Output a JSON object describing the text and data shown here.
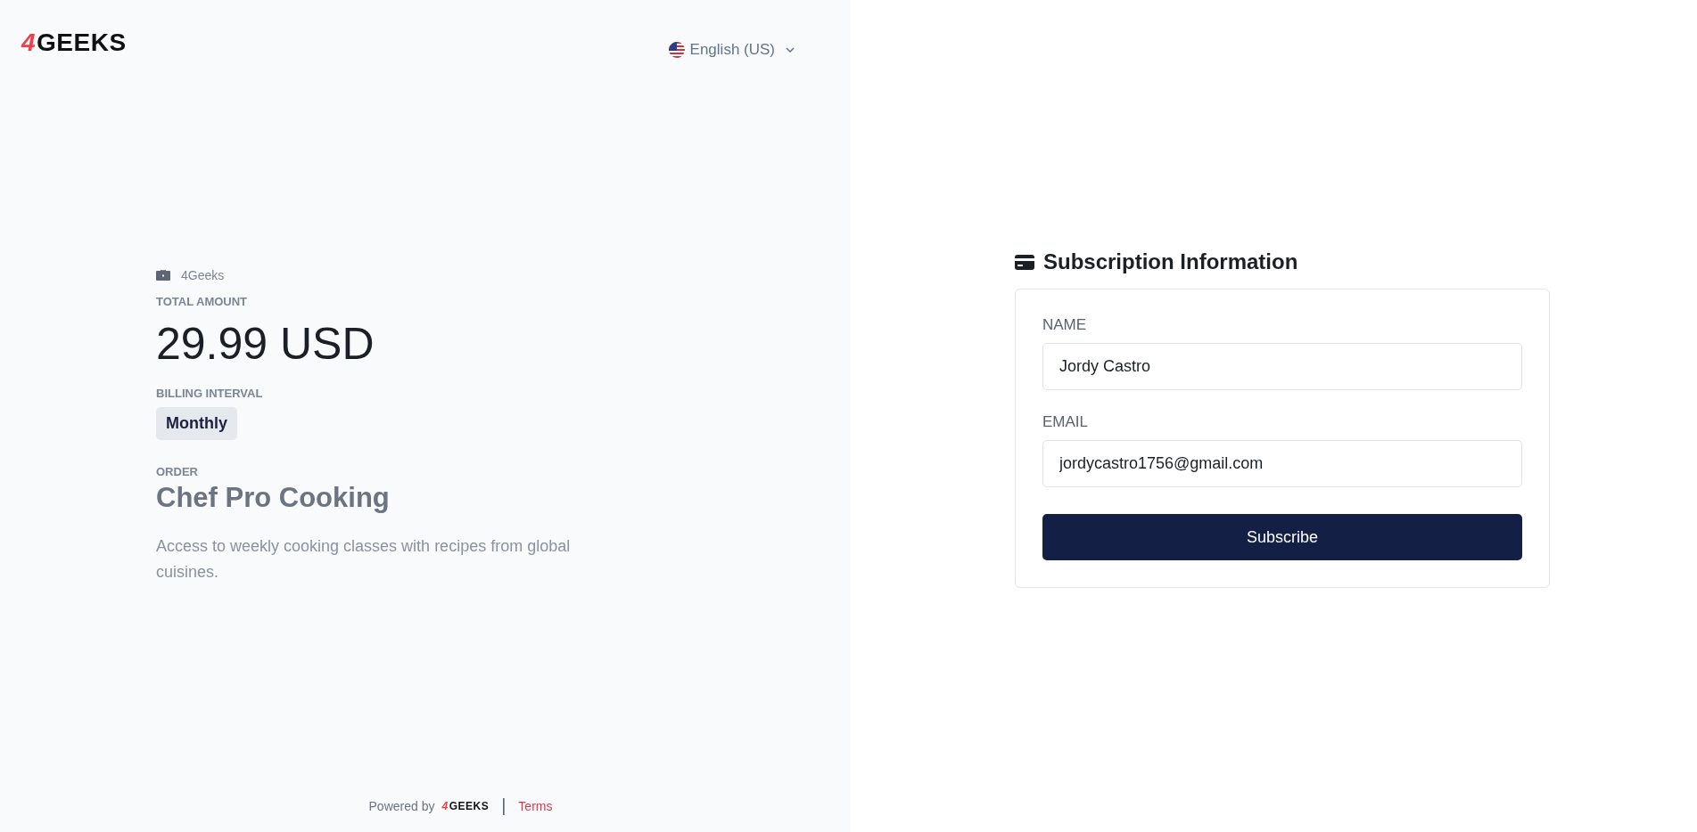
{
  "logo": {
    "mark": "4",
    "text": "GEEKS"
  },
  "language": {
    "label": "English (US)"
  },
  "summary": {
    "provider": "4Geeks",
    "total_label": "TOTAL AMOUNT",
    "total": "29.99 USD",
    "interval_label": "BILLING INTERVAL",
    "interval": "Monthly",
    "order_label": "ORDER",
    "order_title": "Chef Pro Cooking",
    "description": "Access to weekly cooking classes with recipes from global cuisines."
  },
  "footer": {
    "powered_by": "Powered by",
    "logo_mark": "4",
    "logo_text": "GEEKS",
    "separator": "|",
    "terms": "Terms"
  },
  "form": {
    "title": "Subscription Information",
    "fields": [
      {
        "label": "NAME",
        "value": "Jordy Castro"
      },
      {
        "label": "EMAIL",
        "value": "jordycastro1756@gmail.com"
      }
    ],
    "submit": "Subscribe"
  }
}
